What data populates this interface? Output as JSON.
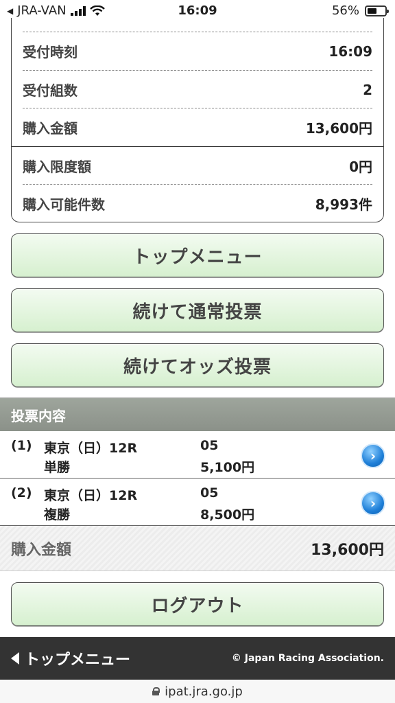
{
  "status_bar": {
    "carrier": "JRA-VAN",
    "time": "16:09",
    "battery_percent": "56%",
    "battery_level": 0.56
  },
  "receipt": {
    "rows": [
      {
        "label": "受付時刻",
        "value": "16:09"
      },
      {
        "label": "受付組数",
        "value": "2"
      },
      {
        "label": "購入金額",
        "value": "13,600円"
      },
      {
        "label": "購入限度額",
        "value": "0円"
      },
      {
        "label": "購入可能件数",
        "value": "8,993件"
      }
    ]
  },
  "buttons": {
    "top_menu": "トップメニュー",
    "continue_normal": "続けて通常投票",
    "continue_odds": "続けてオッズ投票",
    "logout": "ログアウト"
  },
  "bets": {
    "header": "投票内容",
    "items": [
      {
        "num": "(1)",
        "race": "東京（日）12R",
        "type": "単勝",
        "horse": "05",
        "amount": "5,100円"
      },
      {
        "num": "(2)",
        "race": "東京（日）12R",
        "type": "複勝",
        "horse": "05",
        "amount": "8,500円"
      }
    ],
    "total_label": "購入金額",
    "total_value": "13,600円"
  },
  "footer": {
    "back_label": "トップメニュー",
    "copyright": "© Japan Racing Association."
  },
  "url_bar": {
    "url": "ipat.jra.go.jp"
  }
}
